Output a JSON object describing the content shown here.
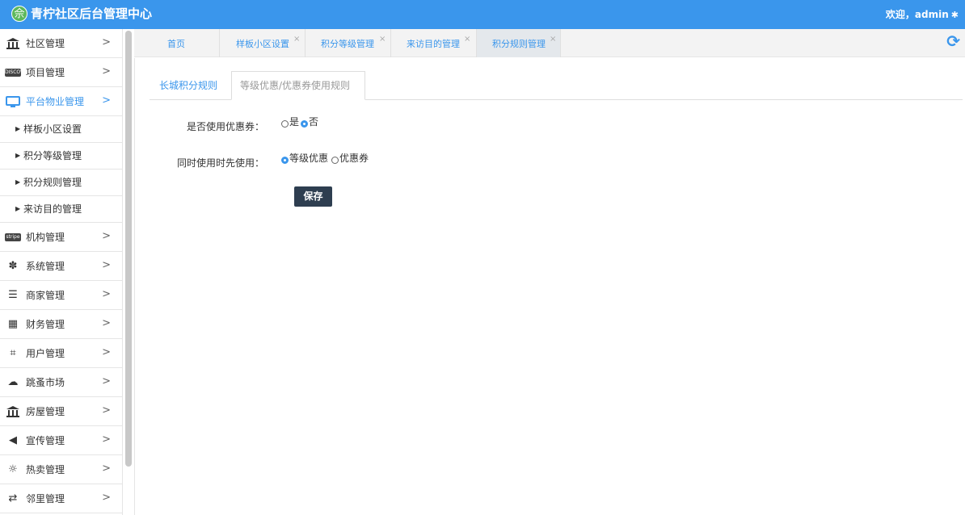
{
  "header": {
    "logo_glyph": "佘",
    "title": "青柠社区后台管理中心",
    "welcome": "欢迎，admin",
    "settings_icon": "gear-icon"
  },
  "sidebar": {
    "menu_top": [
      {
        "label": "社区管理",
        "icon": "bank-icon"
      },
      {
        "label": "项目管理",
        "icon": "discover-card-icon"
      },
      {
        "label": "平台物业管理",
        "icon": "monitor-icon",
        "active": true
      }
    ],
    "sub_items": [
      {
        "label": "样板小区设置"
      },
      {
        "label": "积分等级管理"
      },
      {
        "label": "积分规则管理"
      },
      {
        "label": "来访目的管理"
      }
    ],
    "menu_bottom": [
      {
        "label": "机构管理",
        "icon": "stripe-icon"
      },
      {
        "label": "系统管理",
        "icon": "yelp-icon"
      },
      {
        "label": "商家管理",
        "icon": "bars-icon"
      },
      {
        "label": "财务管理",
        "icon": "calculator-icon"
      },
      {
        "label": "用户管理",
        "icon": "crop-icon"
      },
      {
        "label": "跳蚤市场",
        "icon": "cloud-icon"
      },
      {
        "label": "房屋管理",
        "icon": "bank-icon"
      },
      {
        "label": "宣传管理",
        "icon": "volume-icon"
      },
      {
        "label": "热卖管理",
        "icon": "sun-icon"
      },
      {
        "label": "邻里管理",
        "icon": "retweet-icon"
      }
    ],
    "arrow_glyph": ">"
  },
  "tabs": [
    {
      "label": "首页",
      "closable": false
    },
    {
      "label": "样板小区设置",
      "closable": true
    },
    {
      "label": "积分等级管理",
      "closable": true
    },
    {
      "label": "来访目的管理",
      "closable": true
    },
    {
      "label": "积分规则管理",
      "closable": true,
      "current": true
    }
  ],
  "close_glyph": "×",
  "content": {
    "subtabs": [
      {
        "label": "长城积分规则",
        "active": true
      },
      {
        "label": "等级优惠/优惠券使用规则",
        "active": false
      }
    ],
    "use_coupon": {
      "label": "是否使用优惠券：",
      "options": [
        "是",
        "否"
      ],
      "selected": "否"
    },
    "priority": {
      "label": "同时使用时先使用：",
      "options": [
        "等级优惠",
        "优惠券"
      ],
      "selected": "等级优惠"
    },
    "save_label": "保存"
  },
  "colors": {
    "header_bg": "#3a96ec",
    "accent": "#3a96ec",
    "button_bg": "#2e3e50"
  }
}
